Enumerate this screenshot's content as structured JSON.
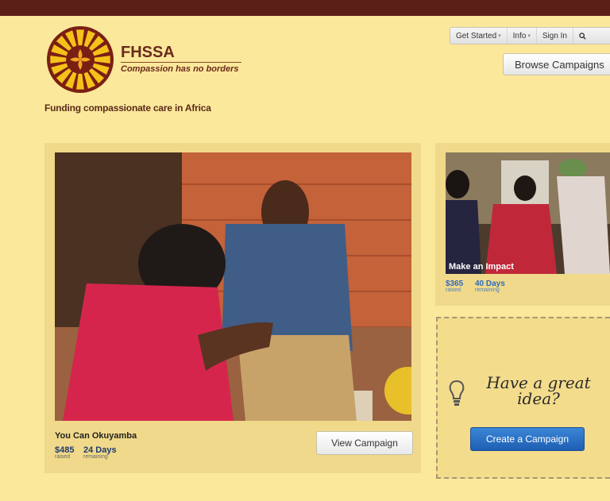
{
  "brand": {
    "name": "FHSSA",
    "slogan": "Compassion has no borders",
    "tagline": "Funding compassionate care in Africa"
  },
  "nav": {
    "items": [
      "Get Started",
      "Info",
      "Sign In"
    ],
    "search_icon": "search-icon"
  },
  "browse_label": "Browse Campaigns",
  "featured": {
    "title": "You Can Okuyamba",
    "raised_value": "$485",
    "raised_label": "raised",
    "days_value": "24 Days",
    "days_label": "remaining",
    "button_label": "View Campaign"
  },
  "side_campaign": {
    "caption": "Make an Impact",
    "raised_value": "$365",
    "raised_label": "raised",
    "days_value": "40 Days",
    "days_label": "remaining"
  },
  "idea": {
    "line1": "Have a great",
    "line2": "idea?",
    "button_label": "Create a Campaign",
    "icon": "lightbulb-icon"
  },
  "colors": {
    "background": "#fbe89b",
    "topbar": "#5b1f18",
    "accent_blue": "#2a6bc4"
  }
}
